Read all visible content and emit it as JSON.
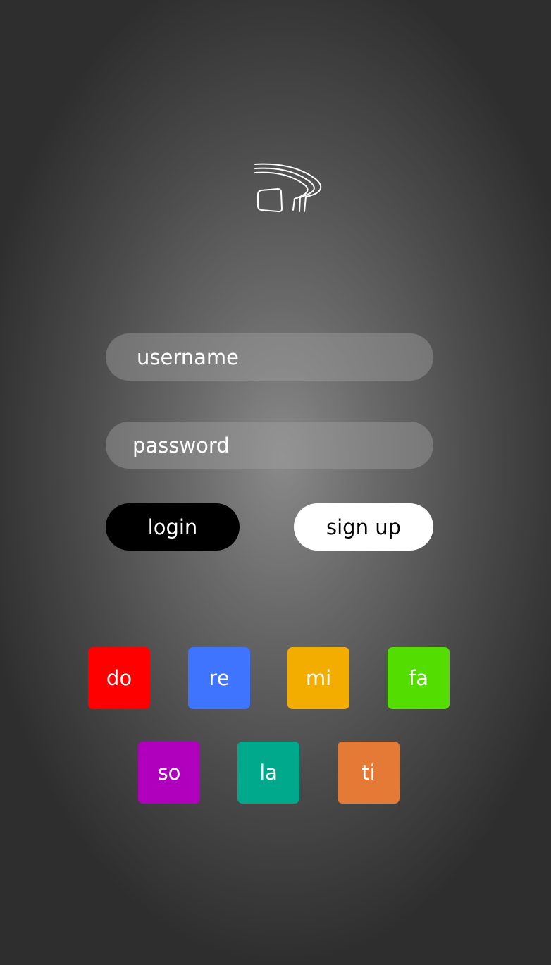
{
  "logo": {
    "icon": "speaker-waves-icon",
    "color": "#ffffff"
  },
  "form": {
    "username_placeholder": "username",
    "password_placeholder": "password"
  },
  "buttons": {
    "login_label": "login",
    "signup_label": "sign up"
  },
  "notes": [
    {
      "label": "do",
      "color": "#fe0000"
    },
    {
      "label": "re",
      "color": "#3e74ff"
    },
    {
      "label": "mi",
      "color": "#f3ad00"
    },
    {
      "label": "fa",
      "color": "#54dd00"
    },
    {
      "label": "so",
      "color": "#b000be"
    },
    {
      "label": "la",
      "color": "#00a88c"
    },
    {
      "label": "ti",
      "color": "#e47a36"
    }
  ]
}
